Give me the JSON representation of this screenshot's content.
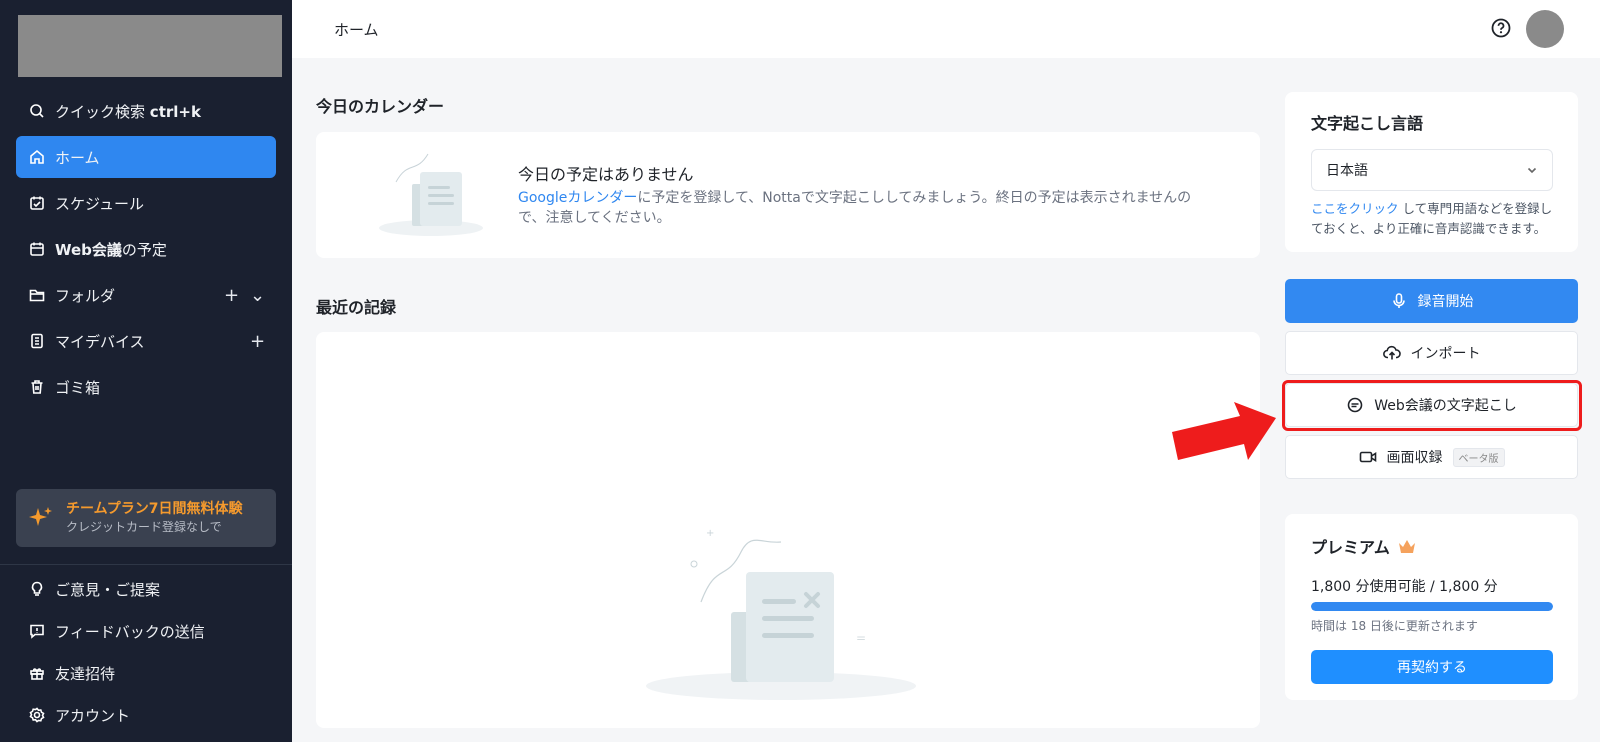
{
  "sidebar": {
    "nav": [
      {
        "label": "クイック検索",
        "shortcut": "ctrl+k",
        "icon": "search-icon"
      },
      {
        "label": "ホーム",
        "icon": "home-icon",
        "active": true
      },
      {
        "label": "スケジュール",
        "icon": "calendar-check-icon"
      },
      {
        "label": "Web会議",
        "suffix": "の予定",
        "icon": "calendar-icon"
      },
      {
        "label": "フォルダ",
        "icon": "folder-icon",
        "actions": [
          "+",
          "⌄"
        ]
      },
      {
        "label": "マイデバイス",
        "icon": "device-icon",
        "actions": [
          "+"
        ]
      },
      {
        "label": "ゴミ箱",
        "icon": "trash-icon"
      }
    ],
    "promo": {
      "title": "チームプラン7日間無料体験",
      "subtitle": "クレジットカード登録なしで",
      "title_color": "#f59a2d"
    },
    "bottom_nav": [
      {
        "label": "ご意見・ご提案",
        "icon": "lightbulb-icon"
      },
      {
        "label": "フィードバックの送信",
        "icon": "feedback-icon"
      },
      {
        "label": "友達招待",
        "icon": "gift-icon"
      },
      {
        "label": "アカウント",
        "icon": "settings-icon"
      }
    ]
  },
  "topbar": {
    "breadcrumb": "ホーム"
  },
  "calendar": {
    "section_title": "今日のカレンダー",
    "empty_title": "今日の予定はありません",
    "link_text": "Googleカレンダー",
    "desc_text": "に予定を登録して、Nottaで文字起こししてみましょう。終日の予定は表示されませんので、注意してください。"
  },
  "records": {
    "section_title": "最近の記録"
  },
  "language": {
    "title": "文字起こし言語",
    "selected": "日本語",
    "help_link": "ここをクリック",
    "help_text": "して専門用語などを登録しておくと、より正確に音声認識できます。"
  },
  "actions": {
    "record": "録音開始",
    "import": "インポート",
    "web_meeting": "Web会議の文字起こし",
    "screen_record": "画面収録",
    "beta": "ベータ版"
  },
  "premium": {
    "title": "プレミアム",
    "usage": "1,800 分使用可能 / 1,800 分",
    "progress": 1.0,
    "note": "時間は 18 日後に更新されます",
    "renew": "再契約する"
  },
  "colors": {
    "accent": "#3289f1",
    "sidebar_bg": "#1a2030",
    "highlight": "#ee1c1c"
  }
}
